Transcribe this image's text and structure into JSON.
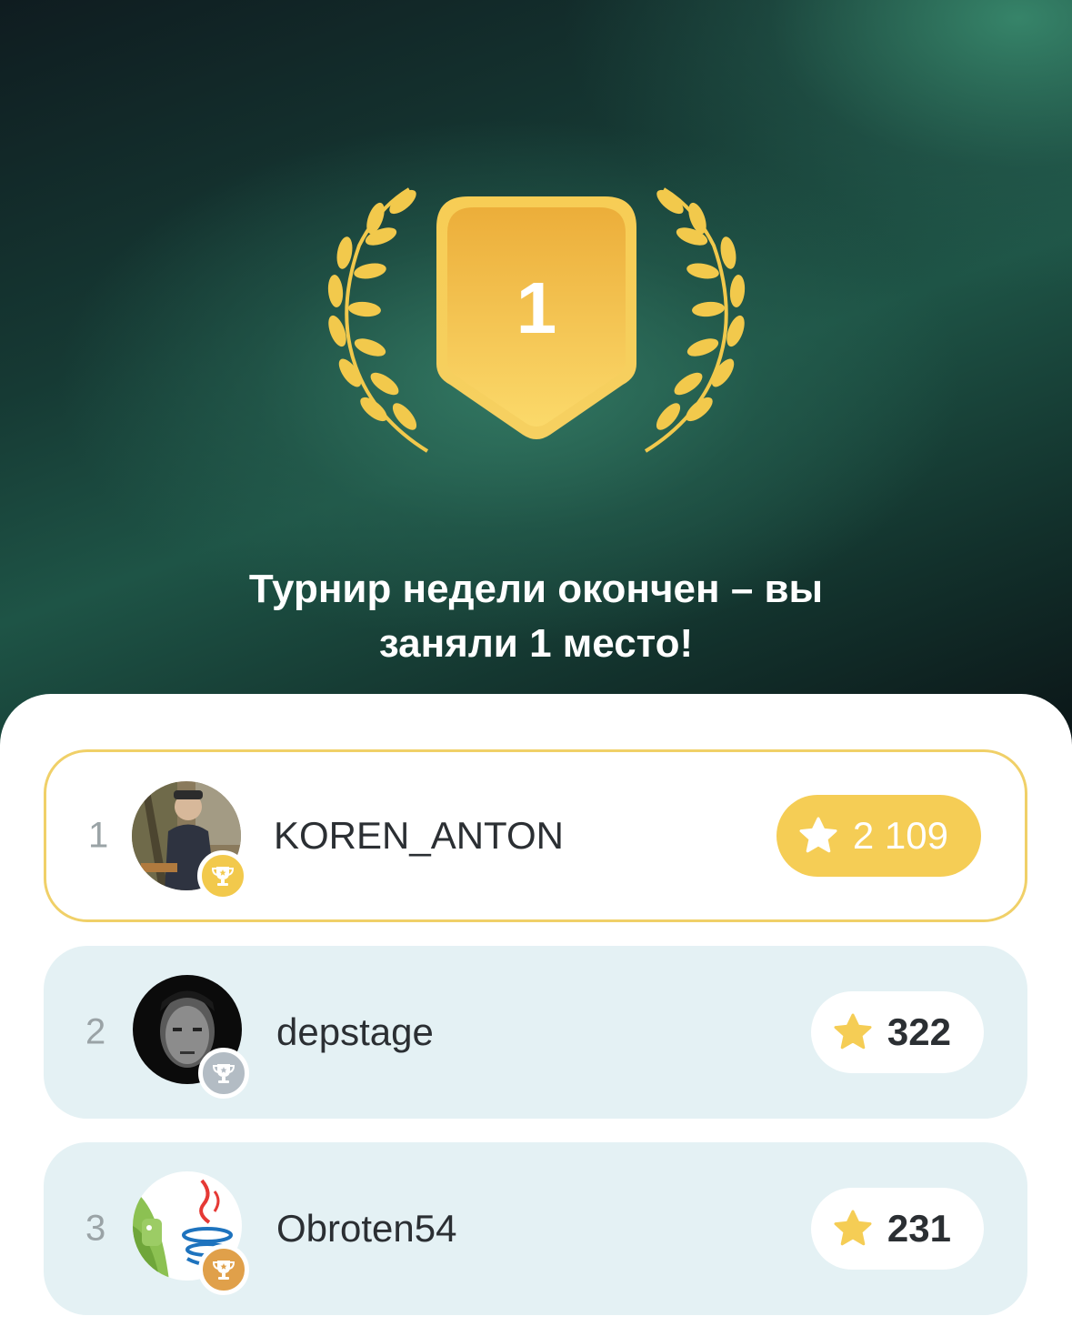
{
  "badge": {
    "place": "1"
  },
  "title": {
    "line1": "Турнир недели окончен – вы",
    "line2": "заняли 1 место!"
  },
  "leaderboard": [
    {
      "rank": "1",
      "name": "KOREN_ANTON",
      "score": "2 109",
      "cup": "gold"
    },
    {
      "rank": "2",
      "name": "depstage",
      "score": "322",
      "cup": "silver"
    },
    {
      "rank": "3",
      "name": "Obroten54",
      "score": "231",
      "cup": "bronze"
    }
  ],
  "colors": {
    "gold": "#f5cd55",
    "row_bg": "#e4f1f4",
    "highlight_border": "#f0d068",
    "cup_gold": "#f2c94c",
    "cup_silver": "#b3bcc4",
    "cup_bronze": "#e0a04a"
  },
  "icons": [
    "laurel-wreath-icon",
    "star-icon",
    "trophy-icon"
  ]
}
